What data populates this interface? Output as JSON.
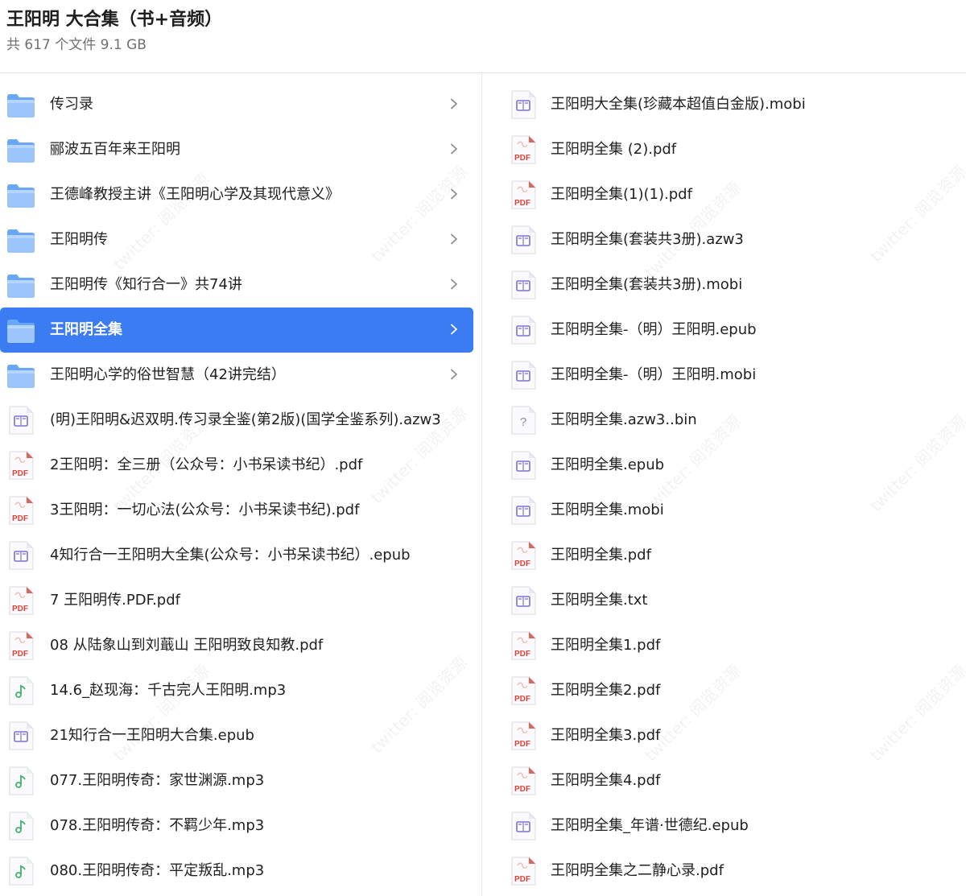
{
  "header": {
    "title": "王阳明 大合集（书+音频）",
    "subtitle": "共 617 个文件 9.1 GB"
  },
  "watermark_text": "twitter: 阅览资源",
  "left_items": [
    {
      "type": "folder",
      "name": "传习录",
      "selected": false
    },
    {
      "type": "folder",
      "name": "郦波五百年来王阳明",
      "selected": false
    },
    {
      "type": "folder",
      "name": "王德峰教授主讲《王阳明心学及其现代意义》",
      "selected": false
    },
    {
      "type": "folder",
      "name": "王阳明传",
      "selected": false
    },
    {
      "type": "folder",
      "name": "王阳明传《知行合一》共74讲",
      "selected": false
    },
    {
      "type": "folder",
      "name": "王阳明全集",
      "selected": true
    },
    {
      "type": "folder",
      "name": "王阳明心学的俗世智慧（42讲完结）",
      "selected": false
    },
    {
      "type": "ebook",
      "name": "(明)王阳明&迟双明.传习录全鉴(第2版)(国学全鉴系列).azw3"
    },
    {
      "type": "pdf",
      "name": "2王阳明：全三册（公众号：小书呆读书纪）.pdf"
    },
    {
      "type": "pdf",
      "name": "3王阳明：一切心法(公众号：小书呆读书纪).pdf"
    },
    {
      "type": "ebook",
      "name": "4知行合一王阳明大全集(公众号：小书呆读书纪）.epub"
    },
    {
      "type": "pdf",
      "name": "7 王阳明传.PDF.pdf"
    },
    {
      "type": "pdf",
      "name": "08 从陆象山到刘蕺山 王阳明致良知教.pdf"
    },
    {
      "type": "audio",
      "name": "14.6_赵现海：千古完人王阳明.mp3"
    },
    {
      "type": "ebook",
      "name": "21知行合一王阳明大合集.epub"
    },
    {
      "type": "audio",
      "name": "077.王阳明传奇：家世渊源.mp3"
    },
    {
      "type": "audio",
      "name": "078.王阳明传奇：不羁少年.mp3"
    },
    {
      "type": "audio",
      "name": "080.王阳明传奇：平定叛乱.mp3"
    }
  ],
  "right_items": [
    {
      "type": "ebook",
      "name": "王阳明大全集(珍藏本超值白金版).mobi"
    },
    {
      "type": "pdf",
      "name": "王阳明全集 (2).pdf"
    },
    {
      "type": "pdf",
      "name": "王阳明全集(1)(1).pdf"
    },
    {
      "type": "ebook",
      "name": "王阳明全集(套装共3册).azw3"
    },
    {
      "type": "ebook",
      "name": "王阳明全集(套装共3册).mobi"
    },
    {
      "type": "ebook",
      "name": "王阳明全集-（明）王阳明.epub"
    },
    {
      "type": "ebook",
      "name": "王阳明全集-（明）王阳明.mobi"
    },
    {
      "type": "unknown",
      "name": "王阳明全集.azw3..bin"
    },
    {
      "type": "ebook",
      "name": "王阳明全集.epub"
    },
    {
      "type": "ebook",
      "name": "王阳明全集.mobi"
    },
    {
      "type": "pdf",
      "name": "王阳明全集.pdf"
    },
    {
      "type": "ebook",
      "name": "王阳明全集.txt"
    },
    {
      "type": "pdf",
      "name": "王阳明全集1.pdf"
    },
    {
      "type": "pdf",
      "name": "王阳明全集2.pdf"
    },
    {
      "type": "pdf",
      "name": "王阳明全集3.pdf"
    },
    {
      "type": "pdf",
      "name": "王阳明全集4.pdf"
    },
    {
      "type": "ebook",
      "name": "王阳明全集_年谱·世德纪.epub"
    },
    {
      "type": "pdf",
      "name": "王阳明全集之二静心录.pdf"
    }
  ],
  "icon_badges": {
    "pdf": "PDF",
    "unknown": "?"
  },
  "colors": {
    "selection": "#3b7cf2",
    "folder": "#6aa7f5",
    "pdf_red": "#e0463a",
    "ebook_purple": "#7b6fe0",
    "audio_green": "#3fb26b"
  }
}
